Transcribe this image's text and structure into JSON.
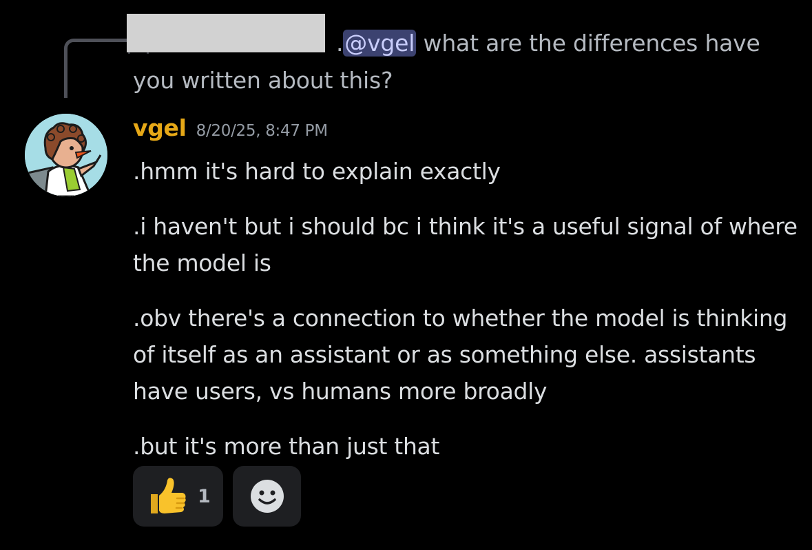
{
  "reply": {
    "prefix": ".",
    "mention": "@vgel",
    "text_line1": "what are the differences have",
    "text_line2": "you written about this?"
  },
  "message": {
    "username": "vgel",
    "username_color": "#e6a817",
    "timestamp": "8/20/25, 8:47 PM",
    "lines": [
      ".hmm it's hard to explain exactly",
      ".i haven't but i should bc i think it's a useful signal of where the model is",
      ".obv there's a connection to whether the model is thinking of itself as an assistant or as something else. assistants have users, vs humans more broadly",
      ".but it's more than just that"
    ]
  },
  "reactions": [
    {
      "icon": "thumbs-up-icon",
      "count": "1"
    }
  ],
  "add_reaction_icon": "smiley-icon"
}
